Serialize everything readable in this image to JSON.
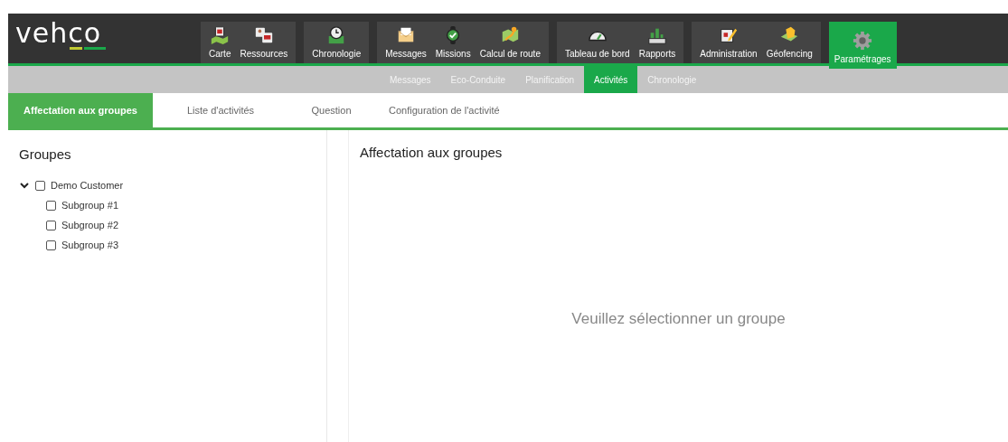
{
  "logo": {
    "name": "vehco"
  },
  "nav_groups": [
    {
      "items": [
        {
          "label": "Carte",
          "kind": "map",
          "selected": false
        },
        {
          "label": "Ressources",
          "kind": "resources",
          "selected": false
        }
      ]
    },
    {
      "items": [
        {
          "label": "Chronologie",
          "kind": "clock",
          "selected": false
        }
      ]
    },
    {
      "items": [
        {
          "label": "Messages",
          "kind": "mail",
          "selected": false
        },
        {
          "label": "Missions",
          "kind": "check",
          "selected": false
        },
        {
          "label": "Calcul de route",
          "kind": "route",
          "selected": false
        }
      ]
    },
    {
      "items": [
        {
          "label": "Tableau de bord",
          "kind": "gauge",
          "selected": false
        },
        {
          "label": "Rapports",
          "kind": "chart",
          "selected": false
        }
      ]
    },
    {
      "items": [
        {
          "label": "Administration",
          "kind": "edit",
          "selected": false
        },
        {
          "label": "Géofencing",
          "kind": "geofence",
          "selected": false
        }
      ]
    },
    {
      "items": [
        {
          "label": "Paramétrages",
          "kind": "gear",
          "selected": true
        }
      ]
    }
  ],
  "sub_nav": [
    {
      "label": "Messages",
      "selected": false
    },
    {
      "label": "Eco-Conduite",
      "selected": false
    },
    {
      "label": "Planification",
      "selected": false
    },
    {
      "label": "Activités",
      "selected": true
    },
    {
      "label": "Chronologie",
      "selected": false
    }
  ],
  "tabs": [
    {
      "label": "Affectation aux groupes",
      "selected": true
    },
    {
      "label": "Liste d'activités",
      "selected": false
    },
    {
      "label": "Question",
      "selected": false
    },
    {
      "label": "Configuration de l'activité",
      "selected": false
    }
  ],
  "groups_panel": {
    "title": "Groupes",
    "tree": [
      {
        "label": "Demo Customer",
        "checked": false,
        "expanded": true,
        "children": [
          {
            "label": "Subgroup #1",
            "checked": false
          },
          {
            "label": "Subgroup #2",
            "checked": false
          },
          {
            "label": "Subgroup #3",
            "checked": false
          }
        ]
      }
    ]
  },
  "detail_panel": {
    "title": "Affectation aux groupes",
    "empty_message": "Veuillez sélectionner un groupe"
  }
}
